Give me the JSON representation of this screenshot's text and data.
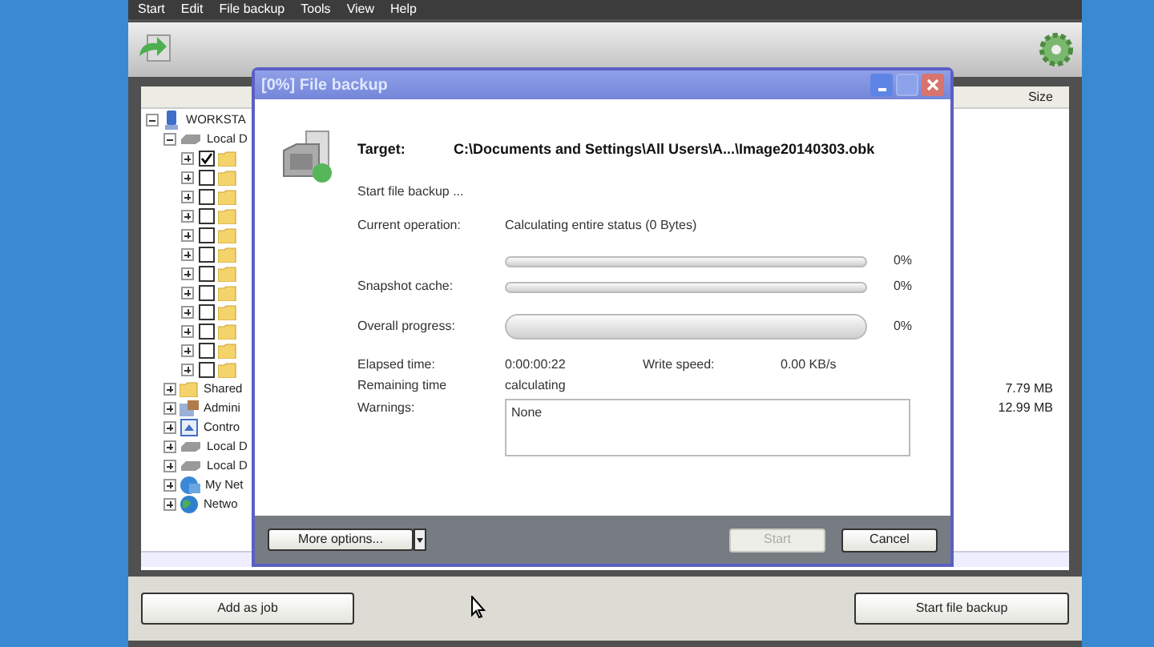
{
  "menu": [
    "Start",
    "Edit",
    "File backup",
    "Tools",
    "View",
    "Help"
  ],
  "tree": {
    "size_header": "Size",
    "items": [
      {
        "kind": "computer",
        "label": "WORKSTA",
        "expanded": true,
        "children": [
          {
            "kind": "drive",
            "label": "Local D",
            "expanded": true,
            "children": [
              {
                "kind": "folder",
                "checked": true
              },
              {
                "kind": "folder",
                "checked": false
              },
              {
                "kind": "folder",
                "checked": false
              },
              {
                "kind": "folder",
                "checked": false
              },
              {
                "kind": "folder",
                "checked": false
              },
              {
                "kind": "folder",
                "checked": false
              },
              {
                "kind": "folder",
                "checked": false
              },
              {
                "kind": "folder",
                "checked": false
              },
              {
                "kind": "folder",
                "checked": false
              },
              {
                "kind": "folder",
                "checked": false
              },
              {
                "kind": "folder",
                "checked": false
              },
              {
                "kind": "folder",
                "checked": false
              }
            ]
          },
          {
            "kind": "shared",
            "label": "Shared",
            "expanded": false,
            "size": "7.79 MB"
          },
          {
            "kind": "admin",
            "label": "Admini",
            "expanded": false,
            "size": "12.99 MB"
          },
          {
            "kind": "control",
            "label": "Contro",
            "expanded": false
          },
          {
            "kind": "drive",
            "label": "Local D",
            "expanded": false
          },
          {
            "kind": "drive",
            "label": "Local D",
            "expanded": false
          },
          {
            "kind": "network",
            "label": "My Net",
            "expanded": false
          },
          {
            "kind": "globe",
            "label": "Netwo",
            "expanded": false
          }
        ]
      }
    ]
  },
  "buttons": {
    "add": "Add as job",
    "start": "Start file backup"
  },
  "dialog": {
    "title": "[0%] File backup",
    "target_label": "Target:",
    "target": "C:\\Documents and Settings\\All Users\\A...\\Image20140303.obk",
    "status": "Start file backup ...",
    "operation_label": "Current operation:",
    "operation": "Calculating entire status (0 Bytes)",
    "bars": [
      {
        "level": 0,
        "reading": "0%",
        "kind": "thin"
      },
      {
        "label": "Snapshot cache:",
        "level": 0,
        "reading": "0%",
        "kind": "thin"
      },
      {
        "label": "Overall progress:",
        "level": 0,
        "reading": "0%",
        "kind": "thick"
      }
    ],
    "elapsed_label": "Elapsed time:",
    "elapsed": "0:00:00:22",
    "speed_label": "Write speed:",
    "speed": "0.00 KB/s",
    "remaining_label": "Remaining time",
    "remaining": "calculating",
    "warnings_label": "Warnings:",
    "warnings": "None",
    "more": "More options...",
    "start": "Start",
    "start_disabled": true,
    "cancel": "Cancel"
  }
}
